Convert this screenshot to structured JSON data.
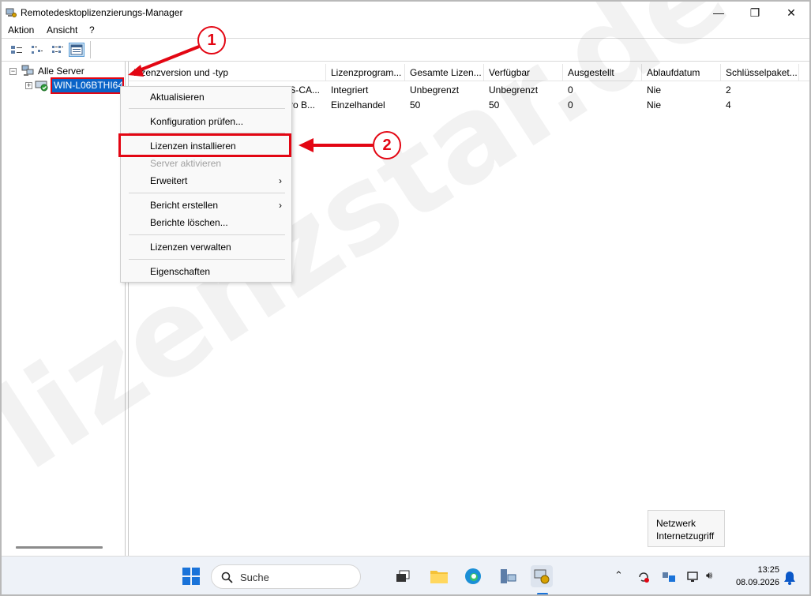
{
  "window": {
    "title": "Remotedesktoplizenzierungs-Manager",
    "minimize": "—",
    "maximize": "❐",
    "close": "✕"
  },
  "menu": {
    "items": [
      "Aktion",
      "Ansicht",
      "?"
    ]
  },
  "tree": {
    "root_label": "Alle Server",
    "server_label": "WIN-L06BTHI64"
  },
  "list": {
    "columns": [
      "Lizenzversion und -typ",
      "Lizenzprogram...",
      "Gesamte Lizen...",
      "Verfügbar",
      "Ausgestellt",
      "Ablaufdatum",
      "Schlüsselpaket..."
    ],
    "rows": [
      [
        "TS-CA...",
        "Integriert",
        "Unbegrenzt",
        "Unbegrenzt",
        "0",
        "Nie",
        "2"
      ],
      [
        "Pro B...",
        "Einzelhandel",
        "50",
        "50",
        "0",
        "Nie",
        "4"
      ]
    ]
  },
  "context_menu": {
    "items": [
      {
        "label": "Aktualisieren",
        "enabled": true
      },
      {
        "label": "Konfiguration prüfen...",
        "enabled": true
      },
      {
        "label": "Lizenzen installieren",
        "enabled": true
      },
      {
        "label": "Server aktivieren",
        "enabled": false
      },
      {
        "label": "Erweitert",
        "enabled": true,
        "submenu": true
      },
      {
        "label": "Bericht erstellen",
        "enabled": true,
        "submenu": true
      },
      {
        "label": "Berichte löschen...",
        "enabled": true
      },
      {
        "label": "Lizenzen verwalten",
        "enabled": true
      },
      {
        "label": "Eigenschaften",
        "enabled": true
      }
    ],
    "submenu_arrow": "›"
  },
  "annotations": {
    "badge1": "1",
    "badge2": "2",
    "color": "#e30613"
  },
  "watermark": "lizenzstar.de",
  "network_tooltip": {
    "line1": "Netzwerk",
    "line2": "Internetzugriff"
  },
  "taskbar": {
    "search_label": "Suche",
    "time": "13:25",
    "date": "08.09.2026"
  },
  "colors": {
    "selection": "#0a64c8",
    "accent": "#e30613"
  }
}
